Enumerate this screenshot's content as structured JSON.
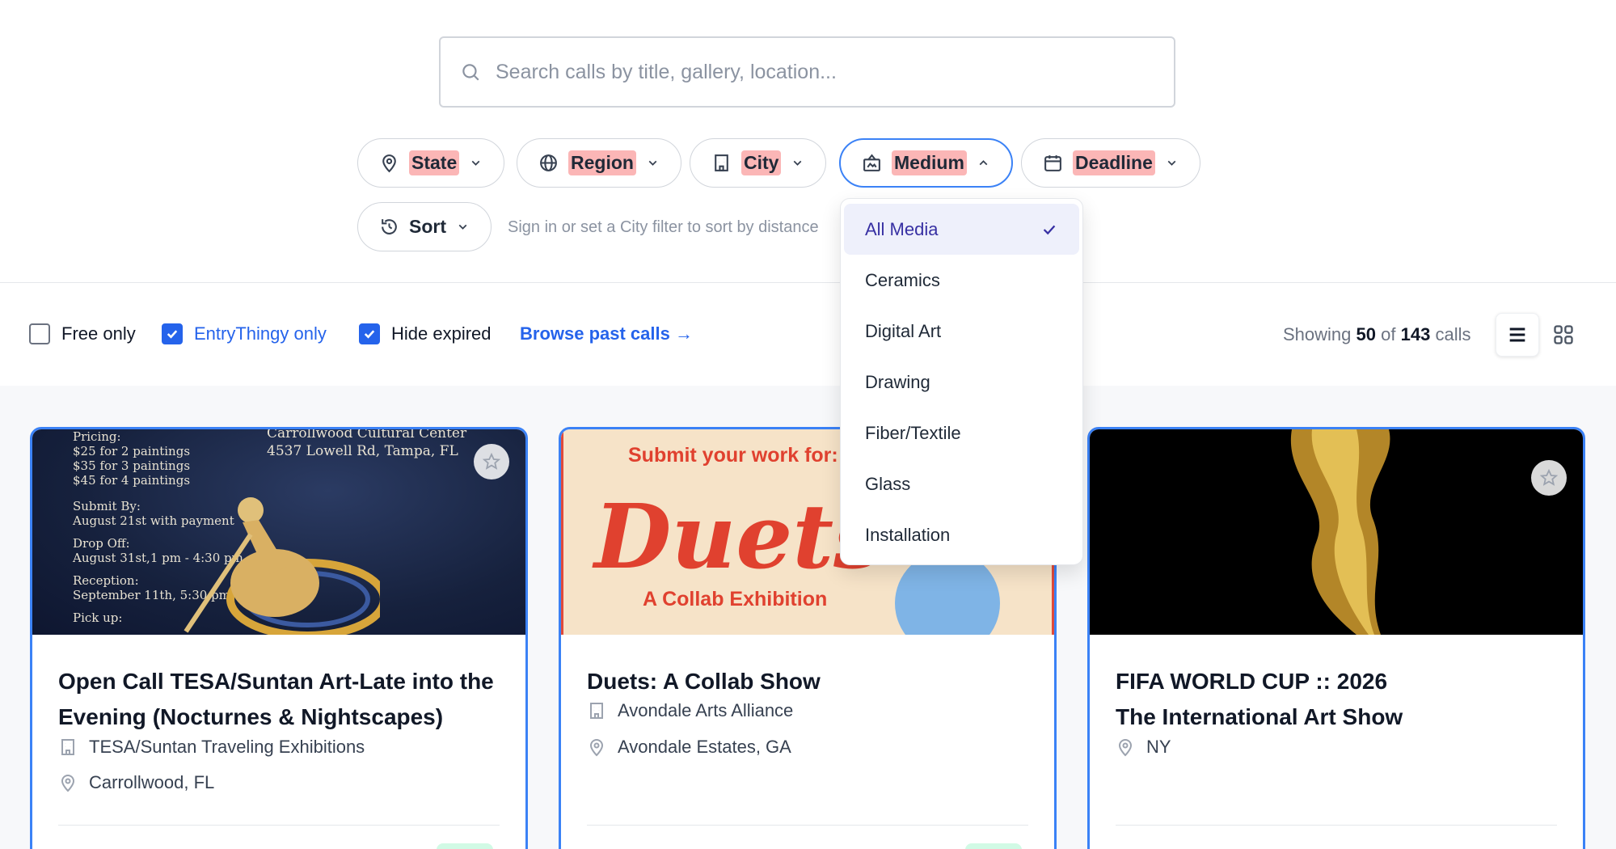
{
  "search": {
    "placeholder": "Search calls by title, gallery, location..."
  },
  "filters": {
    "state": "State",
    "region": "Region",
    "city": "City",
    "medium": "Medium",
    "deadline": "Deadline",
    "sort": "Sort",
    "sort_hint": "Sign in or set a City filter to sort by distance"
  },
  "options": {
    "free_only": {
      "label": "Free only",
      "checked": false
    },
    "entrythingy_only": {
      "label": "EntryThingy only",
      "checked": true
    },
    "hide_expired": {
      "label": "Hide expired",
      "checked": true
    },
    "browse_past": "Browse past calls →"
  },
  "results": {
    "prefix": "Showing",
    "shown": "50",
    "of": "of",
    "total": "143",
    "suffix": "calls"
  },
  "view_modes": [
    "list-view",
    "grid-view"
  ],
  "medium_dropdown": {
    "items": [
      "All Media",
      "Ceramics",
      "Digital Art",
      "Drawing",
      "Fiber/Textile",
      "Glass",
      "Installation"
    ],
    "selected": "All Media"
  },
  "cards": [
    {
      "title": "Open Call TESA/Suntan Art-Late into the Evening (Nocturnes & Nightscapes)",
      "organization": "TESA/Suntan Traveling Exhibitions",
      "location": "Carrollwood, FL",
      "poster": {
        "left_lines": [
          "Pricing:",
          "$25 for 2 paintings",
          "$35 for 3 paintings",
          "$45 for 4 paintings",
          "",
          "Submit By:",
          "August 21st with payment",
          "",
          "Drop Off:",
          "August 31st,1 pm - 4:30 pm",
          "",
          "Reception:",
          "September 11th, 5:30 pm",
          "",
          "Pick up:"
        ],
        "right_lines": [
          "Carrollwood Cultural Center",
          "4537 Lowell Rd, Tampa, FL"
        ]
      }
    },
    {
      "title": "Duets: A Collab Show",
      "organization": "Avondale Arts Alliance",
      "location": "Avondale Estates, GA",
      "poster": {
        "submit": "Submit your work for:",
        "big": "Duets",
        "sub": "A Collab Exhibition"
      }
    },
    {
      "title_line1": "FIFA WORLD CUP :: 2026",
      "title_line2": "The International Art Show",
      "location": "NY"
    }
  ],
  "colors": {
    "accent": "#3b82f6",
    "link": "#2563eb",
    "highlight": "#fbb6b6"
  }
}
